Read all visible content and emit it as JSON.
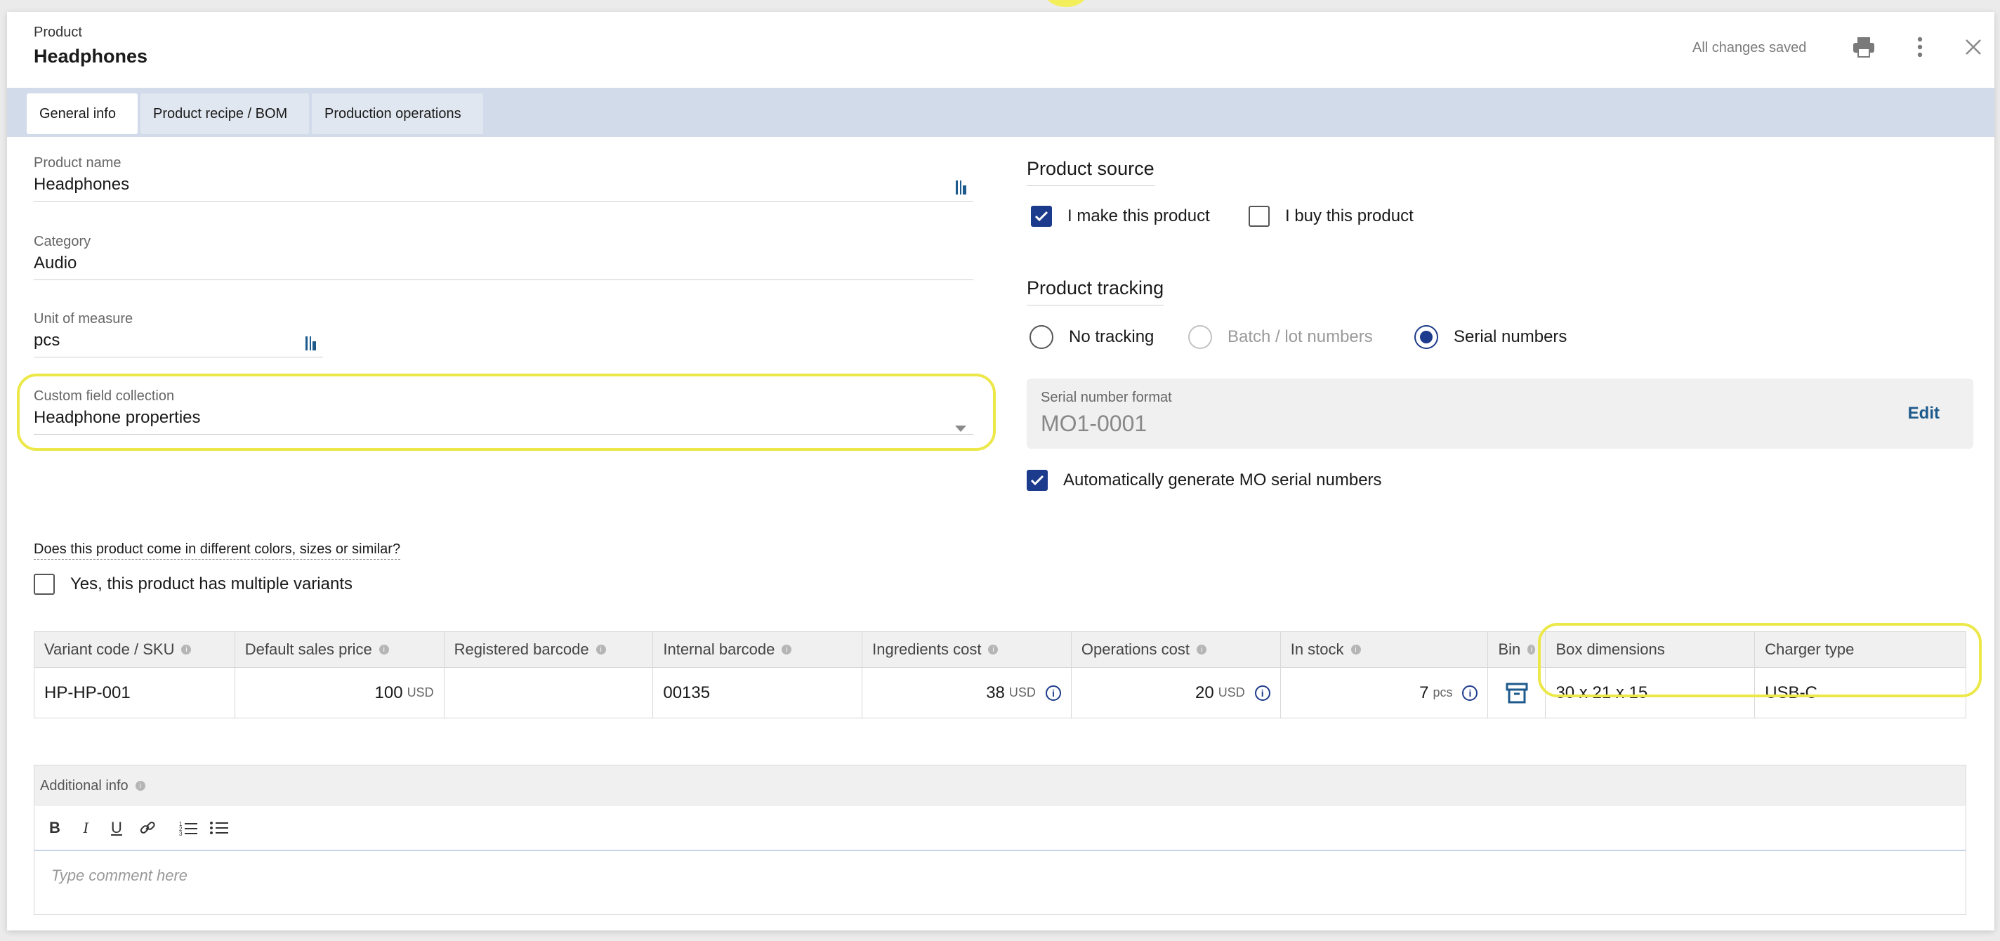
{
  "header": {
    "kicker": "Product",
    "title": "Headphones",
    "status": "All changes saved"
  },
  "tabs": [
    {
      "label": "General info",
      "active": true
    },
    {
      "label": "Product recipe / BOM",
      "active": false
    },
    {
      "label": "Production operations",
      "active": false
    }
  ],
  "fields": {
    "product_name": {
      "label": "Product name",
      "value": "Headphones"
    },
    "category": {
      "label": "Category",
      "value": "Audio"
    },
    "uom": {
      "label": "Unit of measure",
      "value": "pcs"
    },
    "custom_collection": {
      "label": "Custom field collection",
      "value": "Headphone properties"
    }
  },
  "product_source": {
    "title": "Product source",
    "make": {
      "label": "I make this product",
      "checked": true
    },
    "buy": {
      "label": "I buy this product",
      "checked": false
    }
  },
  "product_tracking": {
    "title": "Product tracking",
    "options": [
      {
        "label": "No tracking",
        "selected": false,
        "disabled": false
      },
      {
        "label": "Batch / lot numbers",
        "selected": false,
        "disabled": true
      },
      {
        "label": "Serial numbers",
        "selected": true,
        "disabled": false
      }
    ],
    "serial_format_label": "Serial number format",
    "serial_format_value": "MO1-0001",
    "edit_label": "Edit",
    "auto_generate": {
      "label": "Automatically generate MO serial numbers",
      "checked": true
    }
  },
  "variants": {
    "question": "Does this product come in different colors, sizes or similar?",
    "multiple_label": "Yes, this product has multiple variants",
    "multiple_checked": false
  },
  "grid": {
    "headers": {
      "sku": "Variant code / SKU",
      "price": "Default sales price",
      "reg_barcode": "Registered barcode",
      "int_barcode": "Internal barcode",
      "ingredients": "Ingredients cost",
      "operations": "Operations cost",
      "stock": "In stock",
      "bin": "Bin",
      "box": "Box dimensions",
      "charger": "Charger type"
    },
    "row": {
      "sku": "HP-HP-001",
      "price": "100",
      "price_unit": "USD",
      "reg_barcode": "",
      "int_barcode": "00135",
      "ingredients": "38",
      "ingredients_unit": "USD",
      "operations": "20",
      "operations_unit": "USD",
      "stock": "7",
      "stock_unit": "pcs",
      "box": "30 x 21 x 15",
      "charger": "USB-C"
    }
  },
  "additional_info": {
    "label": "Additional info",
    "placeholder": "Type comment here"
  },
  "colors": {
    "accent": "#1d3b8c",
    "tabbar": "#d1dbe9",
    "highlight": "#ece84a"
  }
}
